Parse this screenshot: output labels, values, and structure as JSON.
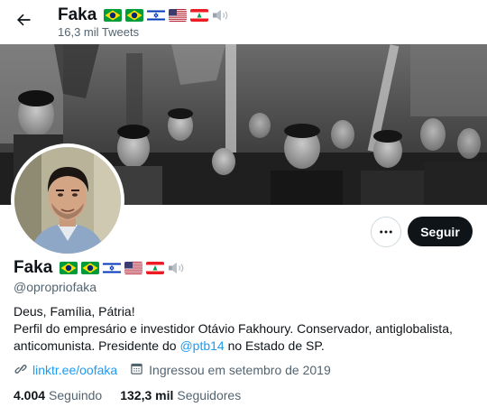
{
  "header": {
    "name": "Faka",
    "tweet_count": "16,3 mil Tweets"
  },
  "profile": {
    "name": "Faka",
    "handle": "@opropriofaka",
    "bio_line1": "Deus, Família, Pátria!",
    "bio_line2_a": "Perfil do empresário e investidor Otávio Fakhoury. Conservador, antiglobalista, anticomunista. Presidente do ",
    "bio_mention": "@ptb14",
    "bio_line2_b": " no Estado de SP.",
    "link": "linktr.ee/oofaka",
    "joined": "Ingressou em setembro de 2019",
    "following_count": "4.004",
    "following_label": "Seguindo",
    "followers_count": "132,3 mil",
    "followers_label": "Seguidores"
  },
  "actions": {
    "follow_label": "Seguir"
  },
  "name_emojis": [
    "brazil-flag",
    "brazil-flag",
    "israel-flag",
    "usa-flag",
    "lebanon-flag",
    "speaker-icon"
  ],
  "colors": {
    "accent": "#1d9bf0",
    "button_dark": "#0f1419",
    "secondary_text": "#536471"
  }
}
